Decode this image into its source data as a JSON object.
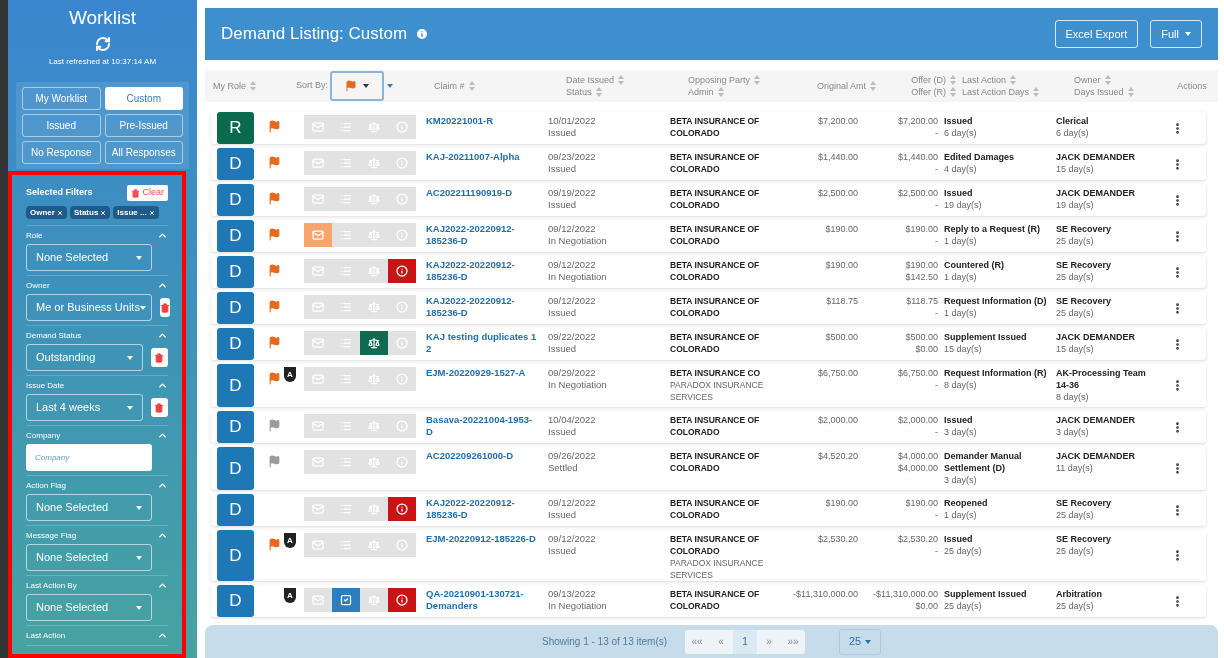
{
  "sidebar": {
    "title": "Worklist",
    "refreshed": "Last refreshed at 10:37:14 AM",
    "views": [
      {
        "label": "My Worklist",
        "selected": false
      },
      {
        "label": "Custom",
        "selected": true
      },
      {
        "label": "Issued",
        "selected": false
      },
      {
        "label": "Pre-Issued",
        "selected": false
      },
      {
        "label": "No Response",
        "selected": false
      },
      {
        "label": "All Responses",
        "selected": false
      }
    ],
    "selected_filters": {
      "title": "Selected Filters",
      "clear": "Clear",
      "chips": [
        "Owner",
        "Status",
        "Issue ..."
      ]
    },
    "filters": [
      {
        "label": "Role",
        "kind": "select",
        "value": "None Selected",
        "removable": false,
        "expanded": true
      },
      {
        "label": "Owner",
        "kind": "select",
        "value": "Me or Business Units",
        "removable": true,
        "expanded": true
      },
      {
        "label": "Demand Status",
        "kind": "select",
        "value": "Outstanding",
        "removable": true,
        "expanded": true
      },
      {
        "label": "Issue Date",
        "kind": "select",
        "value": "Last 4 weeks",
        "removable": true,
        "expanded": true
      },
      {
        "label": "Company",
        "kind": "input",
        "placeholder": "Company",
        "removable": false,
        "expanded": true
      },
      {
        "label": "Action Flag",
        "kind": "select",
        "value": "None Selected",
        "removable": false,
        "expanded": true
      },
      {
        "label": "Message Flag",
        "kind": "select",
        "value": "None Selected",
        "removable": false,
        "expanded": true
      },
      {
        "label": "Last Action By",
        "kind": "select",
        "value": "None Selected",
        "removable": false,
        "expanded": true
      },
      {
        "label": "Last Action",
        "expanded": true
      }
    ]
  },
  "header": {
    "title": "Demand Listing: Custom",
    "buttons": [
      "Excel Export",
      "Full"
    ]
  },
  "table": {
    "columns": [
      {
        "lines": [
          "My Role"
        ],
        "sortable": true
      },
      {
        "lines": [
          "Sort By:"
        ],
        "sortable": false
      },
      {
        "lines": [
          "Claim #"
        ],
        "sortable": true
      },
      {
        "lines": [
          "Date Issued",
          "Status"
        ],
        "sortable": true
      },
      {
        "lines": [
          "Opposing Party",
          "Admin"
        ],
        "sortable": true
      },
      {
        "lines": [
          "Original Amt"
        ],
        "sortable": true
      },
      {
        "lines": [
          "Offer (D)",
          "Offer (R)"
        ],
        "sortable": true
      },
      {
        "lines": [
          "Last Action",
          "Last Action Days"
        ],
        "sortable": true
      },
      {
        "lines": [
          "Owner",
          "Days Issued"
        ],
        "sortable": true
      },
      {
        "lines": [
          "Actions"
        ],
        "sortable": false
      }
    ],
    "rows": [
      {
        "role": {
          "label": "R",
          "color": "#0a6b4c"
        },
        "flag_shown": true,
        "flagged": true,
        "tiles": {
          "message": false,
          "task": false,
          "scale": false,
          "alert": false
        },
        "claim": "KM20221001-R",
        "date": "10/01/2022",
        "status": "Issued",
        "party": "BETA INSURANCE OF COLORADO",
        "original": "$7,200.00",
        "offer_d": "$7,200.00",
        "offer_r": "-",
        "last_action": "Issued",
        "last_action_days": "6 day(s)",
        "owner": "Clerical",
        "days_issued": "6 day(s)"
      },
      {
        "role": {
          "label": "D",
          "color": "#1f78b6"
        },
        "flag_shown": true,
        "flagged": true,
        "tiles": {
          "message": false,
          "task": false,
          "scale": false,
          "alert": false
        },
        "claim": "KAJ-20211007-Alpha",
        "date": "09/23/2022",
        "status": "Issued",
        "party": "BETA INSURANCE OF COLORADO",
        "original": "$1,440.00",
        "offer_d": "$1,440.00",
        "offer_r": "-",
        "last_action": "Edited Damages",
        "last_action_days": "4 day(s)",
        "owner": "JACK DEMANDER",
        "days_issued": "15 day(s)"
      },
      {
        "role": {
          "label": "D",
          "color": "#1f78b6"
        },
        "flag_shown": true,
        "flagged": true,
        "tiles": {
          "message": false,
          "task": false,
          "scale": false,
          "alert": false
        },
        "claim": "AC202211190919-D",
        "date": "09/19/2022",
        "status": "Issued",
        "party": "BETA INSURANCE OF COLORADO",
        "original": "$2,500.00",
        "offer_d": "$2,500.00",
        "offer_r": "-",
        "last_action": "Issued",
        "last_action_days": "19 day(s)",
        "owner": "JACK DEMANDER",
        "days_issued": "19 day(s)"
      },
      {
        "role": {
          "label": "D",
          "color": "#1f78b6"
        },
        "flag_shown": true,
        "flagged": true,
        "tiles": {
          "message": true,
          "task": false,
          "scale": false,
          "alert": false
        },
        "claim": "KAJ2022-20220912-185236-D",
        "date": "09/12/2022",
        "status": "In Negotiation",
        "party": "BETA INSURANCE OF COLORADO",
        "original": "$190.00",
        "offer_d": "$190.00",
        "offer_r": "-",
        "last_action": "Reply to a Request (R)",
        "last_action_days": "1 day(s)",
        "owner": "SE Recovery",
        "days_issued": "25 day(s)"
      },
      {
        "role": {
          "label": "D",
          "color": "#1f78b6"
        },
        "flag_shown": true,
        "flagged": true,
        "tiles": {
          "message": false,
          "task": false,
          "scale": false,
          "alert": true
        },
        "claim": "KAJ2022-20220912-185236-D",
        "date": "09/12/2022",
        "status": "In Negotiation",
        "party": "BETA INSURANCE OF COLORADO",
        "original": "$190.00",
        "offer_d": "$190.00",
        "offer_r": "$142.50",
        "last_action": "Countered (R)",
        "last_action_days": "1 day(s)",
        "owner": "SE Recovery",
        "days_issued": "25 day(s)"
      },
      {
        "role": {
          "label": "D",
          "color": "#1f78b6"
        },
        "flag_shown": true,
        "flagged": true,
        "tiles": {
          "message": false,
          "task": false,
          "scale": false,
          "alert": false
        },
        "claim": "KAJ2022-20220912-185236-D",
        "date": "09/12/2022",
        "status": "Issued",
        "party": "BETA INSURANCE OF COLORADO",
        "original": "$118.75",
        "offer_d": "$118.75",
        "offer_r": "-",
        "last_action": "Request Information (D)",
        "last_action_days": "1 day(s)",
        "owner": "SE Recovery",
        "days_issued": "25 day(s)"
      },
      {
        "role": {
          "label": "D",
          "color": "#1f78b6"
        },
        "flag_shown": true,
        "flagged": true,
        "tiles": {
          "message": false,
          "task": false,
          "scale": true,
          "alert": false
        },
        "claim": "KAJ testing duplicates 1 2",
        "date": "09/22/2022",
        "status": "Issued",
        "party": "BETA INSURANCE OF COLORADO",
        "original": "$500.00",
        "offer_d": "$500.00",
        "offer_r": "$0.00",
        "last_action": "Supplement Issued",
        "last_action_days": "15 day(s)",
        "owner": "JACK DEMANDER",
        "days_issued": "15 day(s)"
      },
      {
        "role": {
          "label": "D",
          "color": "#1f78b6"
        },
        "flag_shown": true,
        "flagged": true,
        "shield": "A",
        "tiles": {
          "message": false,
          "task": false,
          "scale": false,
          "alert": false
        },
        "claim": "EJM-20220929-1527-A",
        "date": "09/29/2022",
        "status": "In Negotiation",
        "party": "BETA INSURANCE CO",
        "admin": "PARADOX INSURANCE SERVICES",
        "original": "$6,750.00",
        "offer_d": "$6,750.00",
        "offer_r": "-",
        "last_action": "Request Information (R)",
        "last_action_days": "8 day(s)",
        "owner": "AK-Processing Team 14-36",
        "days_issued": "8 day(s)"
      },
      {
        "role": {
          "label": "D",
          "color": "#1f78b6"
        },
        "flag_shown": true,
        "flagged": false,
        "tiles": {
          "message": false,
          "task": false,
          "scale": false,
          "alert": false
        },
        "claim": "Basava-20221004-1953-D",
        "date": "10/04/2022",
        "status": "Issued",
        "party": "BETA INSURANCE OF COLORADO",
        "original": "$2,000.00",
        "offer_d": "$2,000.00",
        "offer_r": "-",
        "last_action": "Issued",
        "last_action_days": "3 day(s)",
        "owner": "JACK DEMANDER",
        "days_issued": "3 day(s)"
      },
      {
        "role": {
          "label": "D",
          "color": "#1f78b6"
        },
        "flag_shown": true,
        "flagged": false,
        "tiles": {
          "message": false,
          "task": false,
          "scale": false,
          "alert": false
        },
        "claim": "AC202209261000-D",
        "date": "09/26/2022",
        "status": "Settled",
        "party": "BETA INSURANCE OF COLORADO",
        "original": "$4,520.20",
        "offer_d": "$4,000.00",
        "offer_r": "$4,000.00",
        "last_action": "Demander Manual Settlement (D)",
        "last_action_days": "3 day(s)",
        "owner": "JACK DEMANDER",
        "days_issued": "11 day(s)"
      },
      {
        "role": {
          "label": "D",
          "color": "#1f78b6"
        },
        "flag_shown": false,
        "tiles": {
          "message": false,
          "task": false,
          "scale": false,
          "alert": true
        },
        "claim": "KAJ2022-20220912-185236-D",
        "date": "09/12/2022",
        "status": "Issued",
        "party": "BETA INSURANCE OF COLORADO",
        "original": "$190.00",
        "offer_d": "$190.00",
        "offer_r": "-",
        "last_action": "Reopened",
        "last_action_days": "1 day(s)",
        "owner": "SE Recovery",
        "days_issued": "25 day(s)"
      },
      {
        "role": {
          "label": "D",
          "color": "#1f78b6"
        },
        "flag_shown": true,
        "flagged": true,
        "shield": "A",
        "tiles": {
          "message": false,
          "task": false,
          "scale": false,
          "alert": false
        },
        "claim": "EJM-20220912-185226-D",
        "date": "09/12/2022",
        "status": "Issued",
        "party": "BETA INSURANCE OF COLORADO",
        "admin": "PARADOX INSURANCE SERVICES",
        "original": "$2,530.20",
        "offer_d": "$2,530.20",
        "offer_r": "-",
        "last_action": "Issued",
        "last_action_days": "25 day(s)",
        "owner": "SE Recovery",
        "days_issued": "25 day(s)"
      },
      {
        "role": {
          "label": "D",
          "color": "#1f78b6"
        },
        "flag_shown": false,
        "shield": "A",
        "tiles": {
          "message": false,
          "task": true,
          "scale": false,
          "alert": true
        },
        "claim": "QA-20210901-130721-Demanders",
        "date": "09/13/2022",
        "status": "In Negotiation",
        "party": "BETA INSURANCE OF COLORADO",
        "original": "-$11,310,000.00",
        "offer_d": "-$11,310,000.00",
        "offer_r": "$0.00",
        "last_action": "Supplement Issued",
        "last_action_days": "25 day(s)",
        "owner": "Arbitration",
        "days_issued": "25 day(s)"
      }
    ]
  },
  "footer": {
    "summary": "Showing 1 - 13 of 13 item(s)",
    "pages": [
      {
        "label": "««",
        "selected": false,
        "disabled": true
      },
      {
        "label": "«",
        "selected": false,
        "disabled": true
      },
      {
        "label": "1",
        "selected": true,
        "disabled": false
      },
      {
        "label": "»",
        "selected": false,
        "disabled": true
      },
      {
        "label": "»»",
        "selected": false,
        "disabled": true
      }
    ],
    "page_size": "25"
  }
}
